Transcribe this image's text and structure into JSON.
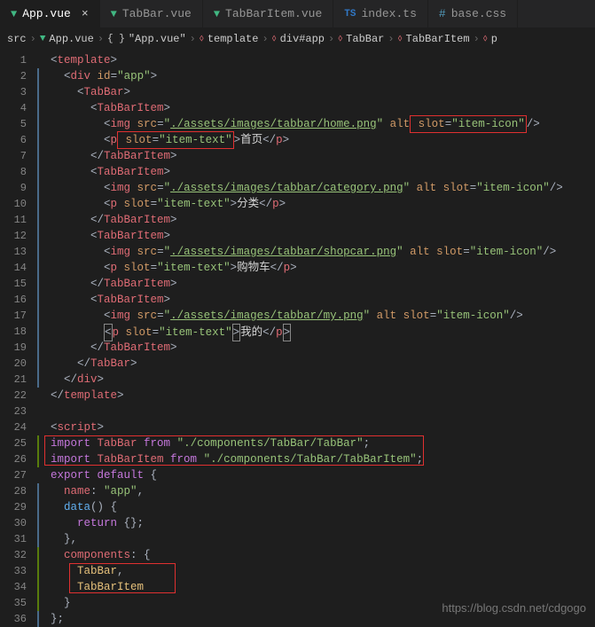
{
  "tabs": [
    {
      "label": "App.vue",
      "active": true,
      "icon": "vue"
    },
    {
      "label": "TabBar.vue",
      "active": false,
      "icon": "vue"
    },
    {
      "label": "TabBarItem.vue",
      "active": false,
      "icon": "vue"
    },
    {
      "label": "index.ts",
      "active": false,
      "icon": "ts"
    },
    {
      "label": "base.css",
      "active": false,
      "icon": "hash"
    }
  ],
  "breadcrumb": {
    "parts": [
      "src",
      "App.vue",
      "\"App.vue\"",
      "template",
      "div#app",
      "TabBar",
      "TabBarItem",
      "p"
    ]
  },
  "gutter": {
    "lines": 36
  },
  "code": {
    "l1a": "<",
    "l1b": "template",
    "l1c": ">",
    "l2a": "<",
    "l2b": "div",
    "l2c": " id",
    "l2d": "=",
    "l2e": "\"app\"",
    "l2f": ">",
    "l3a": "<",
    "l3b": "TabBar",
    "l3c": ">",
    "l4a": "<",
    "l4b": "TabBarItem",
    "l4c": ">",
    "l5a": "<",
    "l5b": "img",
    "l5c": " src",
    "l5d": "=",
    "l5e": "\"",
    "l5f": "./assets/images/tabbar/home.png",
    "l5g": "\"",
    "l5h": " alt",
    "l5i": " slot",
    "l5j": "=",
    "l5k": "\"item-icon\"",
    "l5l": "/>",
    "l6a": "<",
    "l6b": "p",
    "l6c": " slot",
    "l6d": "=",
    "l6e": "\"item-text\"",
    "l6f": ">",
    "l6g": "首页",
    "l6h": "</",
    "l6i": "p",
    "l6j": ">",
    "l7a": "</",
    "l7b": "TabBarItem",
    "l7c": ">",
    "l8a": "<",
    "l8b": "TabBarItem",
    "l8c": ">",
    "l9a": "<",
    "l9b": "img",
    "l9c": " src",
    "l9d": "=",
    "l9e": "\"",
    "l9f": "./assets/images/tabbar/category.png",
    "l9g": "\"",
    "l9h": " alt",
    "l9i": " slot",
    "l9j": "=",
    "l9k": "\"item-icon\"",
    "l9l": "/>",
    "l10a": "<",
    "l10b": "p",
    "l10c": " slot",
    "l10d": "=",
    "l10e": "\"item-text\"",
    "l10f": ">",
    "l10g": "分类",
    "l10h": "</",
    "l10i": "p",
    "l10j": ">",
    "l11a": "</",
    "l11b": "TabBarItem",
    "l11c": ">",
    "l12a": "<",
    "l12b": "TabBarItem",
    "l12c": ">",
    "l13a": "<",
    "l13b": "img",
    "l13c": " src",
    "l13d": "=",
    "l13e": "\"",
    "l13f": "./assets/images/tabbar/shopcar.png",
    "l13g": "\"",
    "l13h": " alt",
    "l13i": " slot",
    "l13j": "=",
    "l13k": "\"item-icon\"",
    "l13l": "/>",
    "l14a": "<",
    "l14b": "p",
    "l14c": " slot",
    "l14d": "=",
    "l14e": "\"item-text\"",
    "l14f": ">",
    "l14g": "购物车",
    "l14h": "</",
    "l14i": "p",
    "l14j": ">",
    "l15a": "</",
    "l15b": "TabBarItem",
    "l15c": ">",
    "l16a": "<",
    "l16b": "TabBarItem",
    "l16c": ">",
    "l17a": "<",
    "l17b": "img",
    "l17c": " src",
    "l17d": "=",
    "l17e": "\"",
    "l17f": "./assets/images/tabbar/my.png",
    "l17g": "\"",
    "l17h": " alt",
    "l17i": " slot",
    "l17j": "=",
    "l17k": "\"item-icon\"",
    "l17l": "/>",
    "l18a": "<",
    "l18b": "p",
    "l18c": " slot",
    "l18d": "=",
    "l18e": "\"item-text\"",
    "l18f": ">",
    "l18g": "我的",
    "l18h": "</",
    "l18i": "p",
    "l18j": ">",
    "l19a": "</",
    "l19b": "TabBarItem",
    "l19c": ">",
    "l20a": "</",
    "l20b": "TabBar",
    "l20c": ">",
    "l21a": "</",
    "l21b": "div",
    "l21c": ">",
    "l22a": "</",
    "l22b": "template",
    "l22c": ">",
    "l24a": "<",
    "l24b": "script",
    "l24c": ">",
    "l25a": "import",
    "l25b": " TabBar ",
    "l25c": "from",
    "l25d": " \"./components/TabBar/TabBar\"",
    "l25e": ";",
    "l26a": "import",
    "l26b": " TabBarItem ",
    "l26c": "from",
    "l26d": " \"./components/TabBar/TabBarItem\"",
    "l26e": ";",
    "l27a": "export",
    "l27b": " default",
    "l27c": " {",
    "l28a": "name",
    "l28b": ": ",
    "l28c": "\"app\"",
    "l28d": ",",
    "l29a": "data",
    "l29b": "() {",
    "l30a": "return",
    "l30b": " {};",
    "l31a": "},",
    "l32a": "components",
    "l32b": ": {",
    "l33a": "TabBar",
    "l33b": ",",
    "l34a": "TabBarItem",
    "l35a": "}",
    "l36a": "};"
  },
  "watermark": "https://blog.csdn.net/cdgogo"
}
